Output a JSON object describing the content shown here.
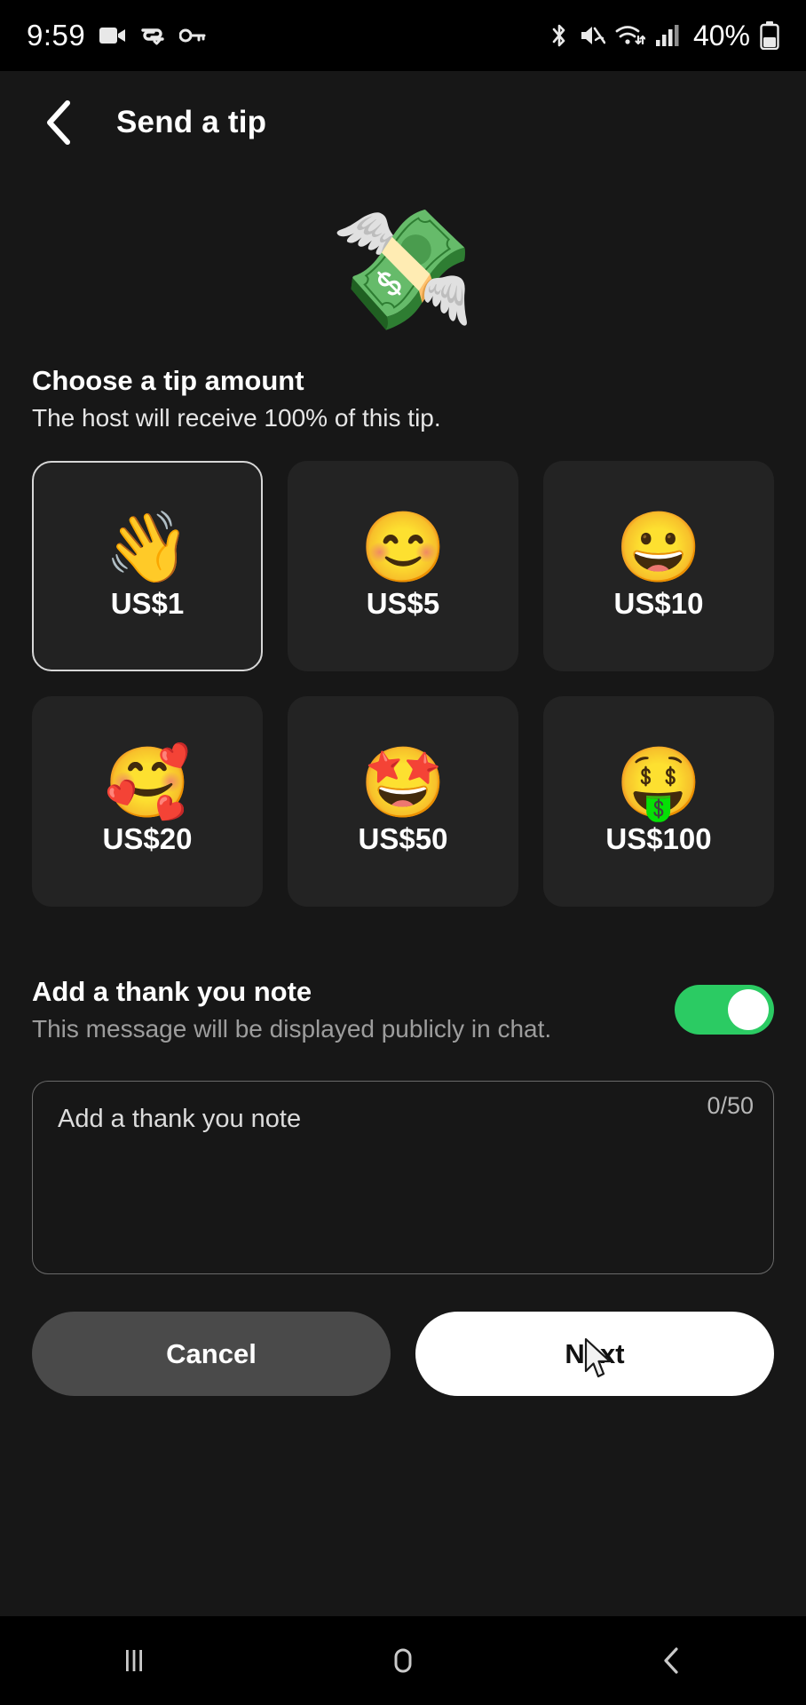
{
  "status_bar": {
    "time": "9:59",
    "battery_percent": "40%",
    "left_icons": [
      "video-camera-icon",
      "vpn-icon",
      "key-icon"
    ],
    "right_icons": [
      "bluetooth-icon",
      "mute-icon",
      "wifi-icon",
      "signal-icon",
      "battery-icon"
    ]
  },
  "header": {
    "back_icon": "chevron-left-icon",
    "title": "Send a tip"
  },
  "hero": {
    "emoji": "💸",
    "emoji_name": "money-with-wings-emoji"
  },
  "tip_section": {
    "title": "Choose a tip amount",
    "subtitle": "The host will receive 100% of this tip.",
    "selected_index": 0,
    "options": [
      {
        "label": "US$1",
        "emoji": "👋",
        "emoji_name": "waving-hand-emoji",
        "selected": true
      },
      {
        "label": "US$5",
        "emoji": "😊",
        "emoji_name": "smiling-face-emoji",
        "selected": false
      },
      {
        "label": "US$10",
        "emoji": "😀",
        "emoji_name": "grinning-face-emoji",
        "selected": false
      },
      {
        "label": "US$20",
        "emoji": "🥰",
        "emoji_name": "smiling-face-hearts-emoji",
        "selected": false
      },
      {
        "label": "US$50",
        "emoji": "🤩",
        "emoji_name": "star-struck-emoji",
        "selected": false
      },
      {
        "label": "US$100",
        "emoji": "🤑",
        "emoji_name": "money-mouth-face-emoji",
        "selected": false
      }
    ]
  },
  "note_section": {
    "title": "Add a thank you note",
    "subtitle": "This message will be displayed publicly in chat.",
    "toggle_on": true,
    "textarea_placeholder": "Add a thank you note",
    "textarea_value": "",
    "char_counter": "0/50"
  },
  "actions": {
    "cancel_label": "Cancel",
    "next_label": "Next"
  },
  "nav_bar": {
    "recents_icon": "recents-icon",
    "home_icon": "home-icon",
    "back_icon": "back-icon"
  },
  "colors": {
    "page_background": "#171717",
    "card_background": "#232323",
    "toggle_on": "#2bcb63",
    "primary_button": "#ffffff",
    "secondary_button": "#4a4a4a"
  }
}
